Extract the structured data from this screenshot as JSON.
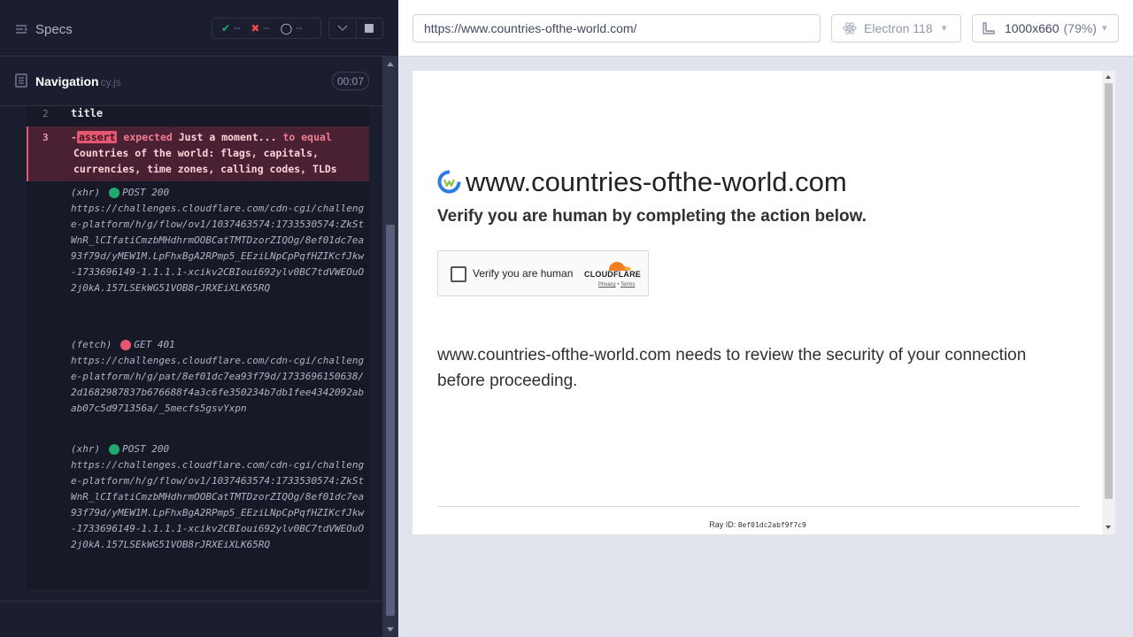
{
  "reporter": {
    "specs_label": "Specs",
    "stats": {
      "passed": {
        "glyph": "✔",
        "value": "--"
      },
      "failed": {
        "glyph": "✖",
        "value": "--"
      },
      "pending": {
        "glyph": "◯",
        "value": "--"
      }
    },
    "spec": {
      "name": "Navigation",
      "ext": "cy.js",
      "duration": "00:07"
    },
    "commands": [
      {
        "num": "2",
        "title": "title"
      },
      {
        "num": "3",
        "badge": "assert",
        "dash": "-",
        "line1": {
          "pre": "expected",
          "strong": "Just a moment...",
          "post": "to equal"
        },
        "line2": "Countries of the world: flags, capitals,",
        "line3": "currencies, time zones, calling codes, TLDs"
      }
    ],
    "requests": [
      {
        "type": "(xhr)",
        "status": "POST 200",
        "ok": true,
        "url": "https://challenges.cloudflare.com/cdn-cgi/challenge-platform/h/g/flow/ov1/1037463574:1733530574:ZkStWnR_lCIfatiCmzbMHdhrmOOBCatTMTDzorZIQOg/8ef01dc7ea93f79d/yMEW1M.LpFhxBgA2RPmp5_EEziLNpCpPqfHZIKcfJkw-1733696149-1.1.1.1-xcikv2CBIoui692ylv0BC7tdVWEOuO2j0kA.157LSEkWG51VOB8rJRXEiXLK65RQ"
      },
      {
        "type": "(fetch)",
        "status": "GET 401",
        "ok": false,
        "url": "https://challenges.cloudflare.com/cdn-cgi/challenge-platform/h/g/pat/8ef01dc7ea93f79d/1733696150638/2d1682987837b676688f4a3c6fe350234b7db1fee4342092abab07c5d971356a/_5mecfs5gsvYxpn"
      },
      {
        "type": "(xhr)",
        "status": "POST 200",
        "ok": true,
        "url": "https://challenges.cloudflare.com/cdn-cgi/challenge-platform/h/g/flow/ov1/1037463574:1733530574:ZkStWnR_lCIfatiCmzbMHdhrmOOBCatTMTDzorZIQOg/8ef01dc7ea93f79d/yMEW1M.LpFhxBgA2RPmp5_EEziLNpCpPqfHZIKcfJkw-1733696149-1.1.1.1-xcikv2CBIoui692ylv0BC7tdVWEOuO2j0kA.157LSEkWG51VOB8rJRXEiXLK65RQ"
      }
    ]
  },
  "aut": {
    "url": "https://www.countries-ofthe-world.com/",
    "browser": "Electron 118",
    "viewport": "1000x660",
    "zoom": "(79%)"
  },
  "page": {
    "site_title": "www.countries-ofthe-world.com",
    "verify_heading": "Verify you are human by completing the action below.",
    "turnstile_label": "Verify you are human",
    "cf_brand": "CLOUDFLARE",
    "cf_privacy": "Privacy",
    "cf_sep": " • ",
    "cf_terms": "Terms",
    "security_msg": "www.countries-ofthe-world.com needs to review the security of your connection before proceeding.",
    "ray_label": "Ray ID: ",
    "ray_code": "8ef01dc2abf9f7c9"
  },
  "colors": {
    "reporter_bg": "#1b1e2e",
    "assert_bg": "#4a2132",
    "pass": "#1fa971",
    "fail": "#e45770",
    "cloudflare_orange": "#f38020"
  }
}
